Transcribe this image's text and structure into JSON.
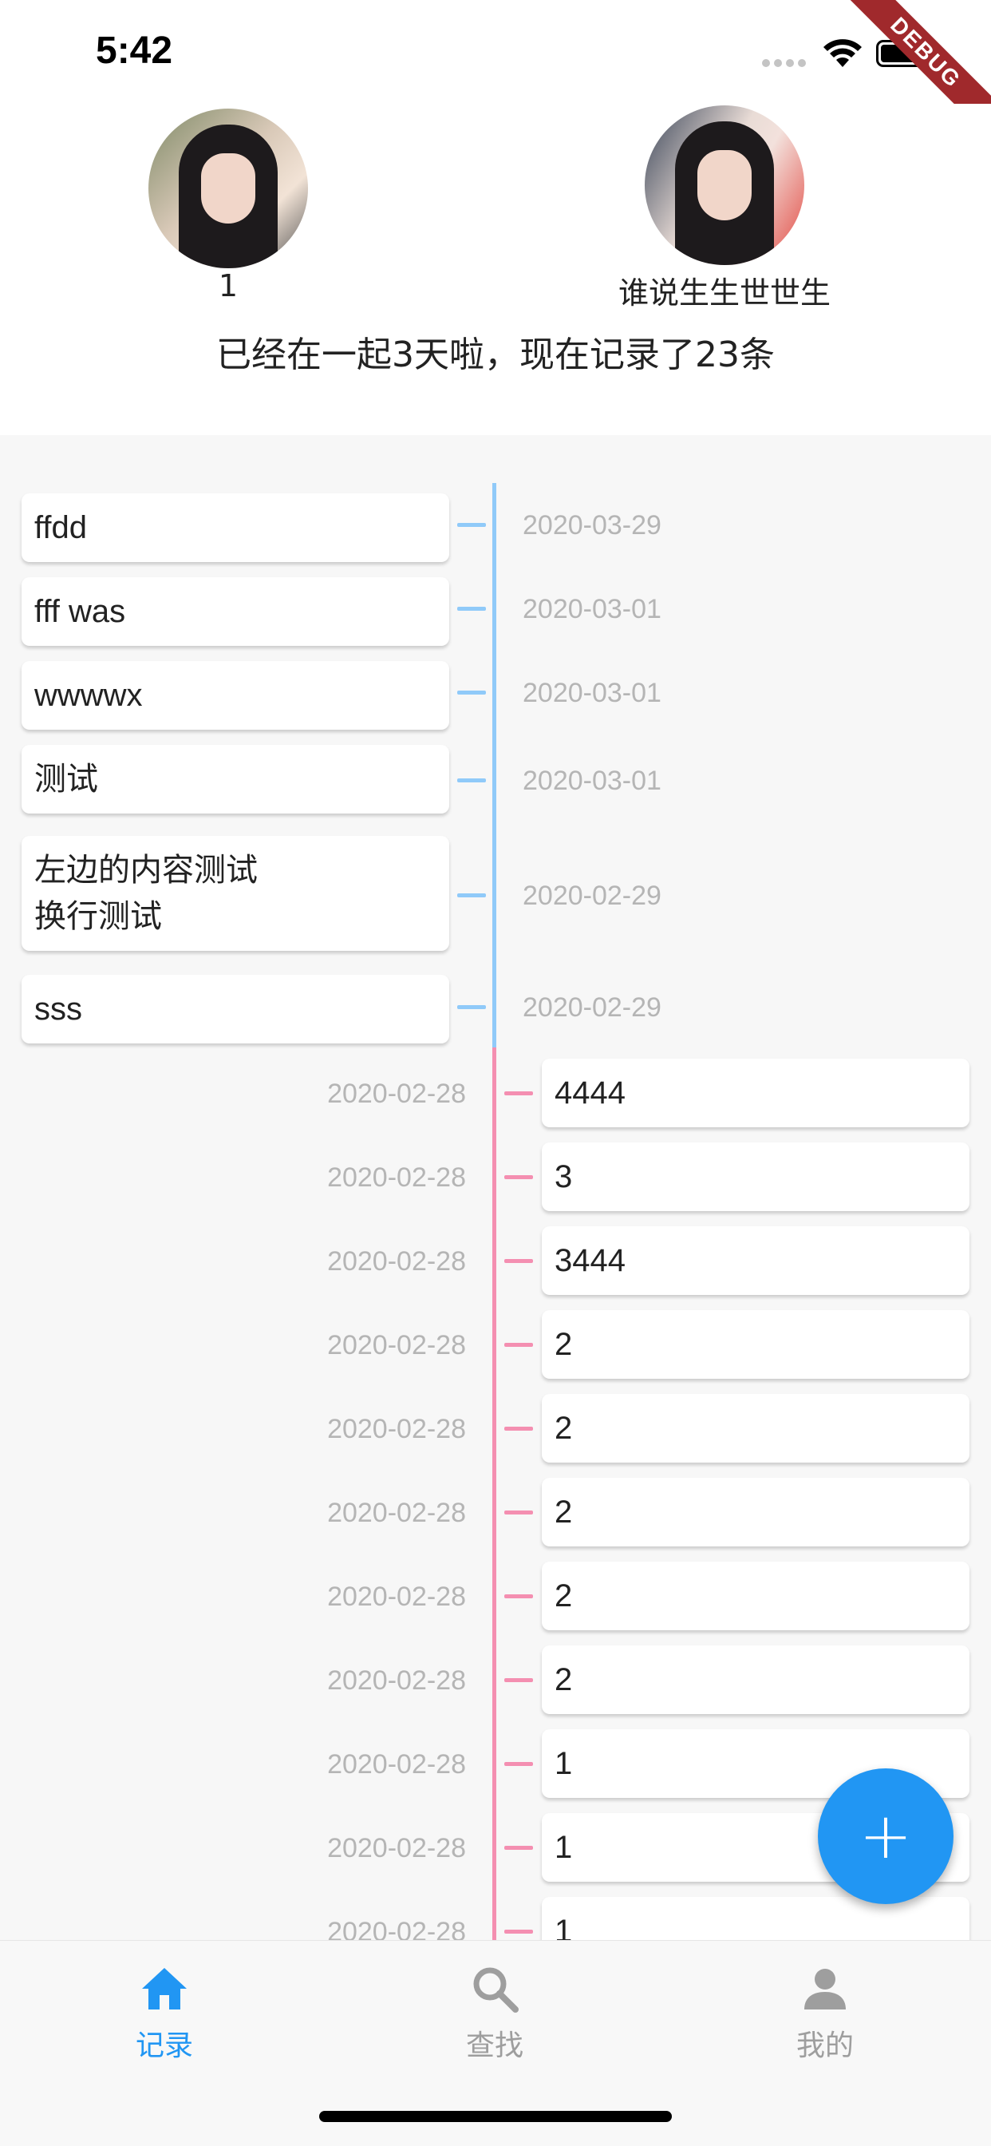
{
  "status_bar": {
    "time": "5:42"
  },
  "debug_banner": {
    "label": "DEBUG"
  },
  "header": {
    "left_user": {
      "name": "1"
    },
    "right_user": {
      "name": "谁说生生世世生"
    },
    "summary": "已经在一起3天啦，现在记录了23条"
  },
  "timeline": {
    "left_entries": [
      {
        "text": "ffdd",
        "date": "2020-03-29"
      },
      {
        "text": "fff was",
        "date": "2020-03-01"
      },
      {
        "text": "wwwwx",
        "date": "2020-03-01"
      },
      {
        "text": "测试",
        "date": "2020-03-01"
      },
      {
        "text": "左边的内容测试\n换行测试",
        "date": "2020-02-29"
      },
      {
        "text": "sss",
        "date": "2020-02-29"
      }
    ],
    "right_entries": [
      {
        "text": "4444",
        "date": "2020-02-28"
      },
      {
        "text": "3",
        "date": "2020-02-28"
      },
      {
        "text": "3444",
        "date": "2020-02-28"
      },
      {
        "text": "2",
        "date": "2020-02-28"
      },
      {
        "text": "2",
        "date": "2020-02-28"
      },
      {
        "text": "2",
        "date": "2020-02-28"
      },
      {
        "text": "2",
        "date": "2020-02-28"
      },
      {
        "text": "2",
        "date": "2020-02-28"
      },
      {
        "text": "1",
        "date": "2020-02-28"
      },
      {
        "text": "1",
        "date": "2020-02-28"
      },
      {
        "text": "1",
        "date": "2020-02-28"
      }
    ],
    "colors": {
      "left_line": "#90caf9",
      "right_line": "#f48fb1"
    }
  },
  "fab": {
    "icon": "plus-icon",
    "symbol": "+",
    "color": "#2196f3"
  },
  "bottom_nav": {
    "items": [
      {
        "label": "记录",
        "icon": "home-icon",
        "active": true
      },
      {
        "label": "查找",
        "icon": "search-icon",
        "active": false
      },
      {
        "label": "我的",
        "icon": "person-icon",
        "active": false
      }
    ],
    "active_color": "#2196f3",
    "inactive_color": "#9e9e9e"
  }
}
